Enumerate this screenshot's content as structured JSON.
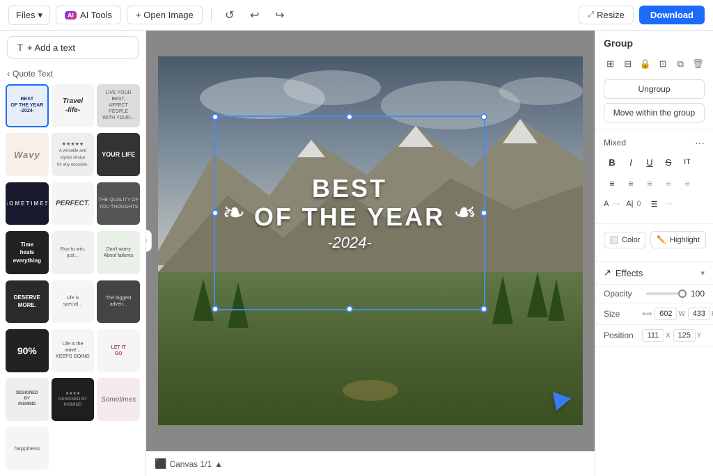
{
  "toolbar": {
    "files_label": "Files",
    "ai_tools_label": "AI Tools",
    "open_image_label": "+ Open Image",
    "resize_label": "Resize",
    "download_label": "Download"
  },
  "left_panel": {
    "add_text_label": "+ Add a text",
    "section_label": "Quote Text",
    "templates": [
      {
        "id": 1,
        "text": "BEST OF THE YEAR -2024-",
        "style": "t1",
        "active": true
      },
      {
        "id": 2,
        "text": "Travel -life-",
        "style": "t2"
      },
      {
        "id": 3,
        "text": "LIVE YOUR BEST...",
        "style": "t3"
      },
      {
        "id": 4,
        "text": "Wavy",
        "style": "t4"
      },
      {
        "id": 5,
        "text": "★★★★★ A versatile...",
        "style": "t5"
      },
      {
        "id": 6,
        "text": "YOUR LIFE",
        "style": "t6"
      },
      {
        "id": 7,
        "text": "SOMETIMES",
        "style": "t7"
      },
      {
        "id": 8,
        "text": "PERFECT.",
        "style": "t8"
      },
      {
        "id": 9,
        "text": "THE QUALITY OF YOU THOUGHTS",
        "style": "t9"
      },
      {
        "id": 10,
        "text": "Time heals everything",
        "style": "t10"
      },
      {
        "id": 11,
        "text": "Run to win, just...",
        "style": "t11"
      },
      {
        "id": 12,
        "text": "Don't worry About failures",
        "style": "t12"
      },
      {
        "id": 13,
        "text": "DESERVE MORE.",
        "style": "t13"
      },
      {
        "id": 14,
        "text": "Life is...",
        "style": "t14"
      },
      {
        "id": 15,
        "text": "The biggest adven...",
        "style": "t15"
      },
      {
        "id": 16,
        "text": "90%",
        "style": "t16"
      },
      {
        "id": 17,
        "text": "Life is the wave... KEEPS GOING",
        "style": "t17"
      },
      {
        "id": 18,
        "text": "LET IT GO",
        "style": "t18"
      },
      {
        "id": 19,
        "text": "DESIGNED BY INSMIND",
        "style": "t19"
      },
      {
        "id": 20,
        "text": "★★★★ DESIGNED BY INSMIND",
        "style": "t20"
      },
      {
        "id": 21,
        "text": "Sometimes",
        "style": "t21"
      },
      {
        "id": 22,
        "text": "happiness",
        "style": "t22"
      }
    ]
  },
  "canvas": {
    "text_main": "BEST\nOF THE YEAR",
    "text_sub": "-2024-",
    "label": "Canvas 1/1"
  },
  "right_panel": {
    "group_title": "Group",
    "ungroup_label": "Ungroup",
    "move_within_group_label": "Move within the group",
    "mixed_label": "Mixed",
    "format_buttons": [
      "B",
      "I",
      "U",
      "S",
      "IT"
    ],
    "color_label": "Color",
    "highlight_label": "Highlight",
    "effects_label": "Effects",
    "opacity_label": "Opacity",
    "opacity_value": "100",
    "size_label": "Size",
    "size_w": "602",
    "size_h": "433",
    "position_label": "Position",
    "position_x": "111",
    "position_y": "125"
  }
}
